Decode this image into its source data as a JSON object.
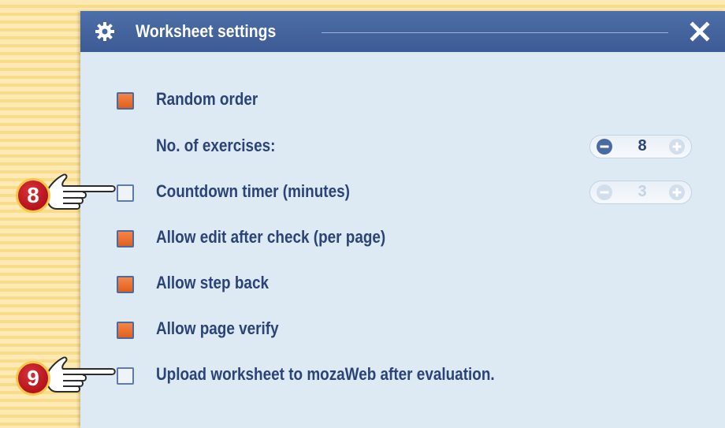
{
  "dialog": {
    "title": "Worksheet settings",
    "title_icon": "gear-icon",
    "close_icon": "close-icon"
  },
  "settings": {
    "random_order": {
      "label": "Random order",
      "checked": true
    },
    "exercises": {
      "label": "No. of exercises:",
      "value": "8",
      "enabled": true
    },
    "countdown": {
      "label": "Countdown timer (minutes)",
      "checked": false,
      "value": "3",
      "enabled": false
    },
    "allow_edit": {
      "label": "Allow edit after check (per page)",
      "checked": true
    },
    "allow_step_back": {
      "label": "Allow step back",
      "checked": true
    },
    "allow_page_verify": {
      "label": "Allow page verify",
      "checked": true
    },
    "upload": {
      "label": "Upload worksheet to mozaWeb after evaluation.",
      "checked": false
    }
  },
  "callouts": {
    "first": {
      "number": "8",
      "icon": "pointing-hand-icon"
    },
    "second": {
      "number": "9",
      "icon": "pointing-hand-icon"
    }
  },
  "colors": {
    "titlebar": "#4a6aa3",
    "panel": "#dde9f3",
    "label": "#2b4375",
    "checked": "#e86a2a",
    "badge": "#c0161f"
  }
}
